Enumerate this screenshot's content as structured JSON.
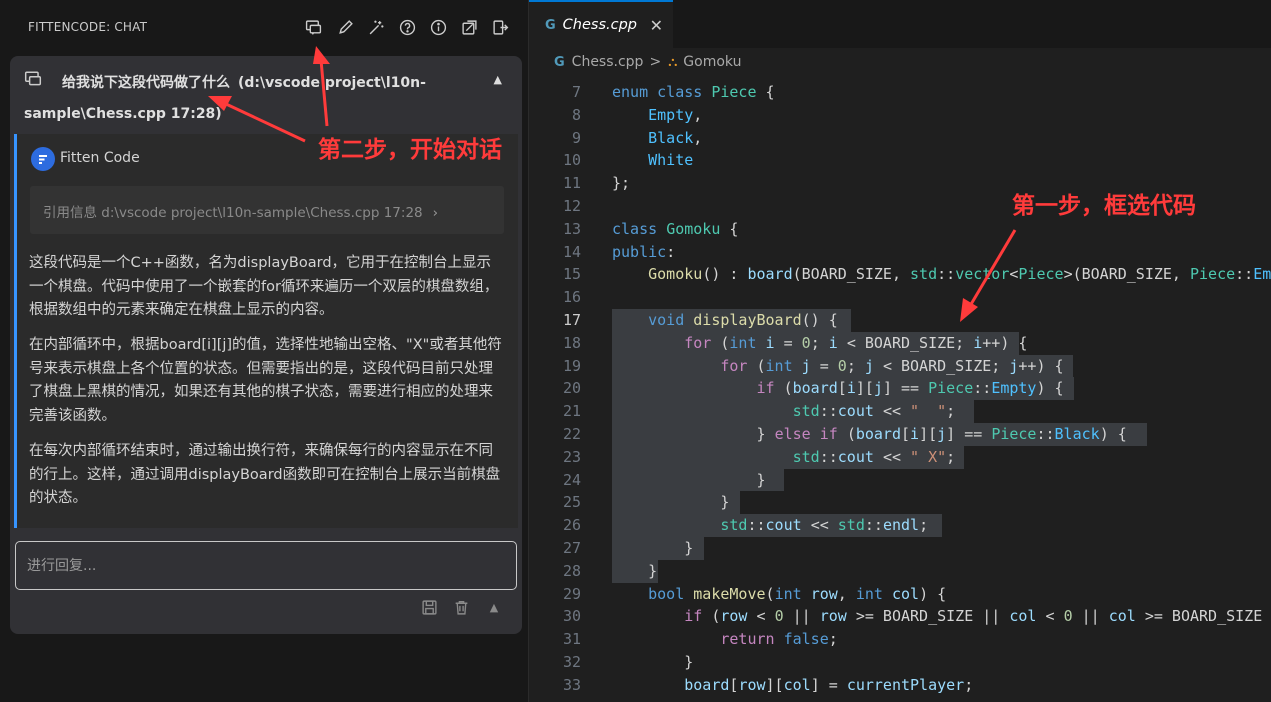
{
  "panel": {
    "title": "FITTENCODE: CHAT",
    "icons": [
      "new-chat-icon",
      "edit-icon",
      "magic-wand-icon",
      "help-icon",
      "info-icon",
      "export-icon",
      "exit-icon"
    ]
  },
  "question": {
    "text": "给我说下这段代码做了什么",
    "ref": "(d:\\vscode project\\l10n-sample\\Chess.cpp 17:28)"
  },
  "answer": {
    "author": "Fitten Code",
    "reference": "引用信息 d:\\vscode project\\l10n-sample\\Chess.cpp 17:28",
    "reference_chevron": "›",
    "paragraphs": [
      "这段代码是一个C++函数，名为displayBoard，它用于在控制台上显示一个棋盘。代码中使用了一个嵌套的for循环来遍历一个双层的棋盘数组，根据数组中的元素来确定在棋盘上显示的内容。",
      "在内部循环中，根据board[i][j]的值，选择性地输出空格、\"X\"或者其他符号来表示棋盘上各个位置的状态。但需要指出的是，这段代码目前只处理了棋盘上黑棋的情况，如果还有其他的棋子状态，需要进行相应的处理来完善该函数。",
      "在每次内部循环结束时，通过输出换行符，来确保每行的内容显示在不同的行上。这样，通过调用displayBoard函数即可在控制台上展示当前棋盘的状态。"
    ]
  },
  "reply": {
    "placeholder": "进行回复..."
  },
  "editor": {
    "tab_label": "Chess.cpp",
    "tab_icon": "G",
    "breadcrumb": {
      "file": "Chess.cpp",
      "separator": ">",
      "symbol": "Gomoku"
    },
    "current_line": 17
  },
  "annotations": {
    "step1": "第一步，框选代码",
    "step2": "第二步，开始对话"
  }
}
